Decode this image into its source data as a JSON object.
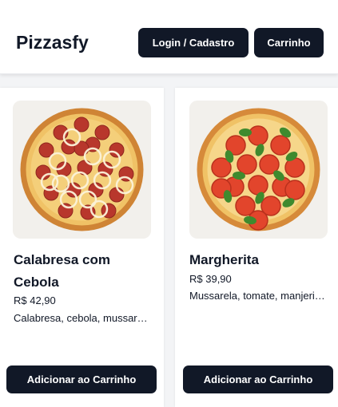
{
  "header": {
    "brand": "Pizzasfy",
    "login_label": "Login / Cadastro",
    "cart_label": "Carrinho"
  },
  "products": [
    {
      "name": "Calabresa com Cebola",
      "price": "R$ 42,90",
      "description": "Calabresa, cebola, mussarela",
      "button_label": "Adicionar ao Carrinho",
      "image_icon": "calabresa-pizza-image"
    },
    {
      "name": "Margherita",
      "price": "R$ 39,90",
      "description": "Mussarela, tomate, manjericão",
      "button_label": "Adicionar ao Carrinho",
      "image_icon": "margherita-pizza-image"
    }
  ],
  "colors": {
    "primary_button": "#111827",
    "background": "#f3f4f6",
    "crust": "#d68a3a",
    "cheese": "#f3c76a",
    "pepperoni": "#b8372c",
    "tomato": "#e2452c",
    "basil": "#3f8a2e"
  }
}
